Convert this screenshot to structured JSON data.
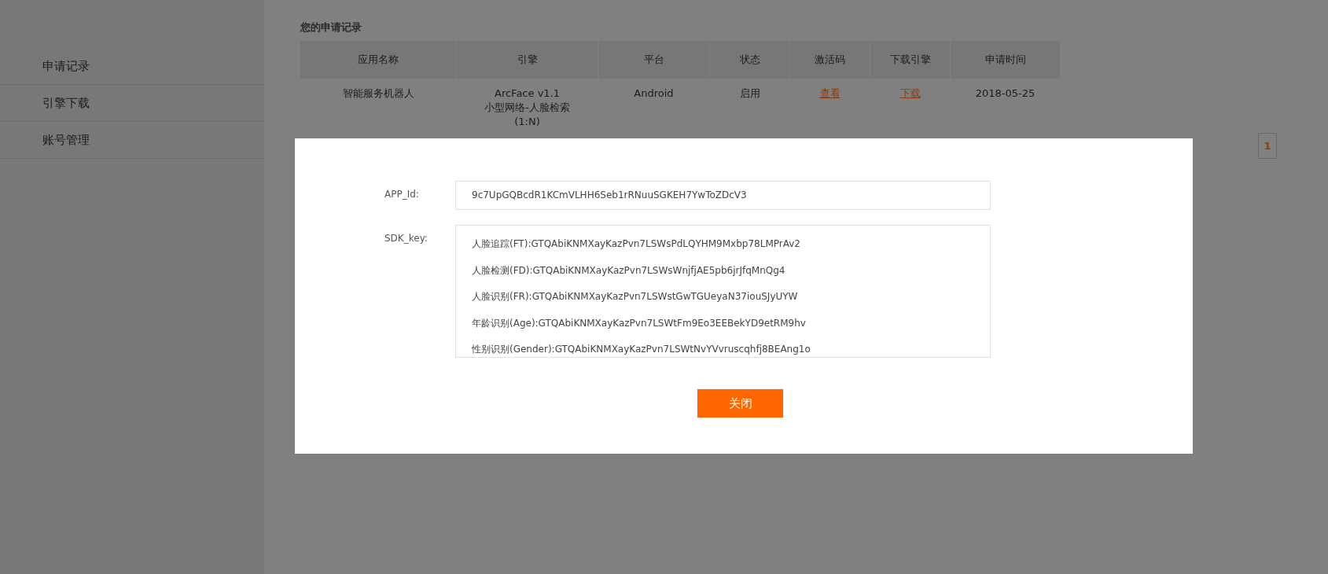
{
  "sidebar": {
    "items": [
      {
        "label": "申请记录"
      },
      {
        "label": "引擎下载"
      },
      {
        "label": "账号管理"
      }
    ]
  },
  "records": {
    "title": "您的申请记录",
    "columns": [
      "应用名称",
      "引擎",
      "平台",
      "状态",
      "激活码",
      "下载引擎",
      "申请时间"
    ],
    "rows": [
      {
        "app_name": "智能服务机器人",
        "engine": [
          "ArcFace v1.1",
          "小型网络-人脸检索",
          "(1:N)"
        ],
        "platform": "Android",
        "status": "启用",
        "activation_code_link": "查看",
        "download_link": "下载",
        "date": "2018-05-25"
      }
    ]
  },
  "pagination": {
    "pages": [
      {
        "label": "1",
        "selected": true
      }
    ]
  },
  "dialog": {
    "app_id": {
      "label": "APP_Id:",
      "value": "9c7UpGQBcdR1KCmVLHH6Seb1rRNuuSGKEH7YwToZDcV3"
    },
    "sdk_key": {
      "label": "SDK_key:",
      "lines": [
        "人脸追踪(FT):GTQAbiKNMXayKazPvn7LSWsPdLQYHM9Mxbp78LMPrAv2",
        "人脸检测(FD):GTQAbiKNMXayKazPvn7LSWsWnjfjAE5pb6jrJfqMnQg4",
        "人脸识别(FR):GTQAbiKNMXayKazPvn7LSWstGwTGUeyaN37iouSJyUYW",
        "年龄识别(Age):GTQAbiKNMXayKazPvn7LSWtFm9Eo3EEBekYD9etRM9hv",
        "性别识别(Gender):GTQAbiKNMXayKazPvn7LSWtNvYVvruscqhfj8BEAng1o"
      ]
    },
    "close_button": "关闭"
  }
}
